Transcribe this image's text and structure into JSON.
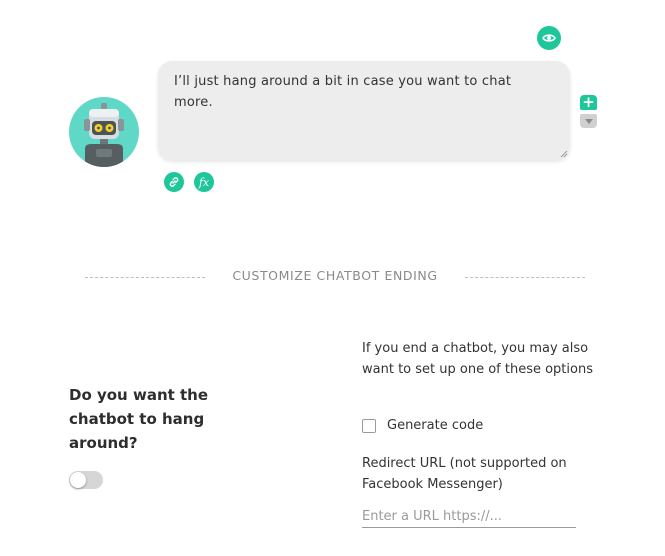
{
  "message": {
    "text": "I’ll just hang around a bit in case you want to chat more."
  },
  "message_actions": {
    "preview_icon": "eye-icon",
    "add_symbol": "+",
    "link_icon": "link-icon",
    "function_label": "fx"
  },
  "section": {
    "title": "CUSTOMIZE CHATBOT ENDING"
  },
  "hang_around": {
    "question": "Do you want the chatbot to hang around?",
    "enabled": false
  },
  "ending_options": {
    "description": "If you end a chatbot, you may also want to set up one of these options",
    "generate_code_label": "Generate code",
    "generate_code_checked": false,
    "redirect_label": "Redirect URL (not supported on Facebook Messenger)",
    "redirect_placeholder": "Enter a URL https://...",
    "redirect_value": ""
  },
  "colors": {
    "accent": "#1ec79a",
    "avatar_bg": "#5fd8c8",
    "bubble_bg": "#ededed"
  }
}
